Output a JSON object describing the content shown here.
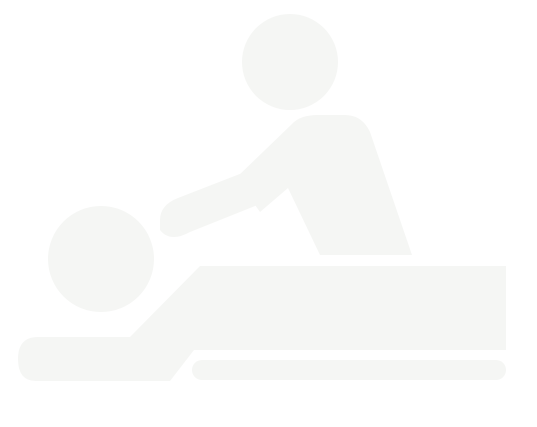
{
  "image": {
    "icon": "massage-therapy-icon",
    "background_color": "#ffffff",
    "figure_color": "#f5f6f4"
  }
}
